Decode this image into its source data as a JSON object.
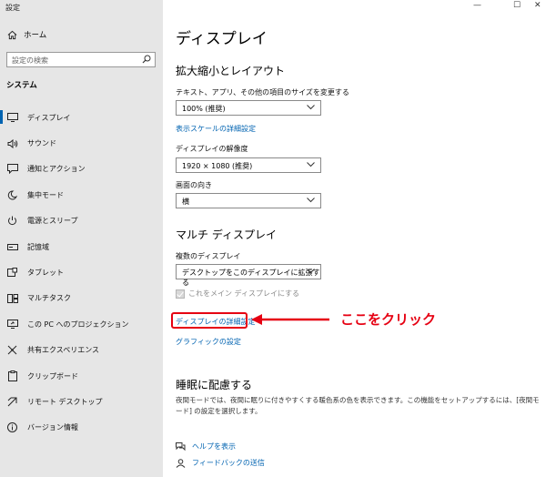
{
  "window": {
    "title": "設定",
    "minimize": "—",
    "maximize": "☐",
    "close": "✕"
  },
  "sidebar": {
    "home": "ホーム",
    "search_placeholder": "設定の検索",
    "section": "システム",
    "items": [
      {
        "label": "ディスプレイ",
        "icon": "monitor-icon",
        "active": true
      },
      {
        "label": "サウンド",
        "icon": "speaker-icon"
      },
      {
        "label": "通知とアクション",
        "icon": "notification-icon"
      },
      {
        "label": "集中モード",
        "icon": "moon-icon"
      },
      {
        "label": "電源とスリープ",
        "icon": "power-icon"
      },
      {
        "label": "記憶域",
        "icon": "storage-icon"
      },
      {
        "label": "タブレット",
        "icon": "tablet-icon"
      },
      {
        "label": "マルチタスク",
        "icon": "multitask-icon"
      },
      {
        "label": "この PC へのプロジェクション",
        "icon": "projection-icon"
      },
      {
        "label": "共有エクスペリエンス",
        "icon": "share-icon"
      },
      {
        "label": "クリップボード",
        "icon": "clipboard-icon"
      },
      {
        "label": "リモート デスクトップ",
        "icon": "remote-icon"
      },
      {
        "label": "バージョン情報",
        "icon": "info-icon"
      }
    ]
  },
  "main": {
    "title": "ディスプレイ",
    "scale_section": "拡大縮小とレイアウト",
    "scale_label": "テキスト、アプリ、その他の項目のサイズを変更する",
    "scale_value": "100% (推奨)",
    "scale_link": "表示スケールの詳細設定",
    "resolution_label": "ディスプレイの解像度",
    "resolution_value": "1920 × 1080 (推奨)",
    "orientation_label": "画面の向き",
    "orientation_value": "横",
    "multi_section": "マルチ ディスプレイ",
    "multi_label": "複数のディスプレイ",
    "multi_value": "デスクトップをこのディスプレイに拡張する",
    "main_display_check": "これをメイン ディスプレイにする",
    "advanced_link": "ディスプレイの詳細設定",
    "graphics_link": "グラフィックの設定",
    "sleep_section": "睡眠に配慮する",
    "sleep_desc": "夜間モードでは、夜間に眠りに付きやすくする暖色系の色を表示できます。この機能をセットアップするには、[夜間モード] の設定を選択します。",
    "help_link": "ヘルプを表示",
    "feedback_link": "フィードバックの送信"
  },
  "annotation": {
    "callout": "ここをクリック",
    "color": "#e60012"
  },
  "colors": {
    "accent": "#0063b1",
    "sidebar_bg": "#e6e6e6"
  }
}
